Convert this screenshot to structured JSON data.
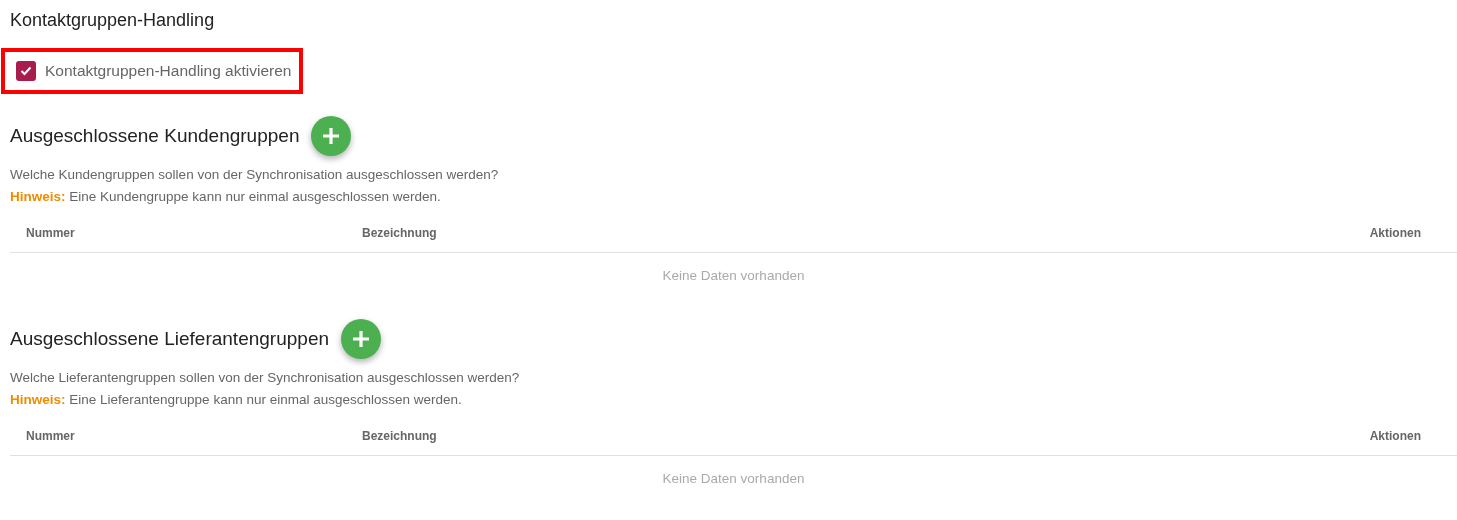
{
  "title": "Kontaktgruppen-Handling",
  "option": {
    "label": "Kontaktgruppen-Handling aktivieren",
    "checked": true,
    "highlighted": true
  },
  "sections": [
    {
      "heading": "Ausgeschlossene Kundengruppen",
      "description": "Welche Kundengruppen sollen von der Synchronisation ausgeschlossen werden?",
      "hint": "**Hinweis:** Eine Kundengruppe kann nur einmal ausgeschlossen werden.",
      "columns": [
        "Nummer",
        "Bezeichnung",
        "Aktionen"
      ],
      "empty_text": "Keine Daten vorhanden"
    },
    {
      "heading": "Ausgeschlossene Lieferantengruppen",
      "description": "Welche Lieferantengruppen sollen von der Synchronisation ausgeschlossen werden?",
      "hint": "**Hinweis:** Eine Lieferantengruppe kann nur einmal ausgeschlossen werden.",
      "columns": [
        "Nummer",
        "Bezeichnung",
        "Aktionen"
      ],
      "empty_text": "Keine Daten vorhanden"
    }
  ]
}
